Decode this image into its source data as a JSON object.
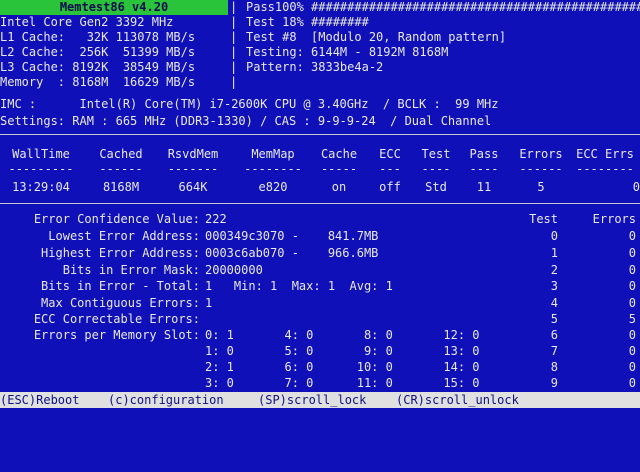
{
  "header": {
    "title": "Memtest86  v4.20",
    "left": [
      "Intel Core Gen2 3392 MHz",
      "L1 Cache:   32K 113078 MB/s",
      "L2 Cache:  256K  51399 MB/s",
      "L3 Cache: 8192K  38549 MB/s",
      "Memory  : 8168M  16629 MB/s"
    ],
    "right": [
      "Pass100% ##################################################",
      "Test 18% ########",
      "Test #8  [Modulo 20, Random pattern]",
      "Testing: 6144M - 8192M 8168M",
      "Pattern: 3833be4a-2"
    ]
  },
  "imc_line": "IMC :      Intel(R) Core(TM) i7-2600K CPU @ 3.40GHz  / BCLK :  99 MHz",
  "settings_line": "Settings: RAM : 665 MHz (DDR3-1330) / CAS : 9-9-9-24  / Dual Channel",
  "status_table": {
    "headers": [
      "WallTime",
      "Cached",
      "RsvdMem",
      "MemMap",
      "Cache",
      "ECC",
      "Test",
      "Pass",
      "Errors",
      "ECC Errs"
    ],
    "dashes": [
      "---------",
      "------",
      "-------",
      "--------",
      "-----",
      "---",
      "----",
      "----",
      "------",
      "--------"
    ],
    "values": [
      "13:29:04",
      "8168M",
      "664K",
      "e820",
      "on",
      "off",
      "Std",
      "11",
      "5",
      "0"
    ]
  },
  "error_info": {
    "rows": [
      {
        "label": "Error Confidence Value:",
        "value": "222"
      },
      {
        "label": "Lowest Error Address:",
        "value": "000349c3070 -    841.7MB"
      },
      {
        "label": "Highest Error Address:",
        "value": "0003c6ab070 -    966.6MB"
      },
      {
        "label": "Bits in Error Mask:",
        "value": "20000000"
      },
      {
        "label": "Bits in Error - Total:",
        "value": "1   Min: 1  Max: 1  Avg: 1"
      },
      {
        "label": "Max Contiguous Errors:",
        "value": "1"
      },
      {
        "label": "ECC Correctable Errors:",
        "value": ""
      },
      {
        "label": "Errors per Memory Slot:",
        "value": ""
      }
    ],
    "slot_rows": [
      "0: 1       4: 0       8: 0       12: 0",
      "1: 0       5: 0       9: 0       13: 0",
      "2: 1       6: 0      10: 0       14: 0",
      "3: 0       7: 0      11: 0       15: 0"
    ]
  },
  "test_errors": {
    "header_test": "Test",
    "header_errors": "Errors",
    "rows": [
      {
        "test": "0",
        "errors": "0"
      },
      {
        "test": "1",
        "errors": "0"
      },
      {
        "test": "2",
        "errors": "0"
      },
      {
        "test": "3",
        "errors": "0"
      },
      {
        "test": "4",
        "errors": "0"
      },
      {
        "test": "5",
        "errors": "5"
      },
      {
        "test": "6",
        "errors": "0"
      },
      {
        "test": "7",
        "errors": "0"
      },
      {
        "test": "8",
        "errors": "0"
      },
      {
        "test": "9",
        "errors": "0"
      }
    ]
  },
  "footer": {
    "esc": "(ESC)Reboot",
    "config": "(c)configuration",
    "sp": "(SP)scroll_lock",
    "cr": "(CR)scroll_unlock"
  },
  "colors": {
    "background": "#1010b8",
    "title_bg": "#29c43a",
    "footer_bg": "#e0e0e0"
  }
}
